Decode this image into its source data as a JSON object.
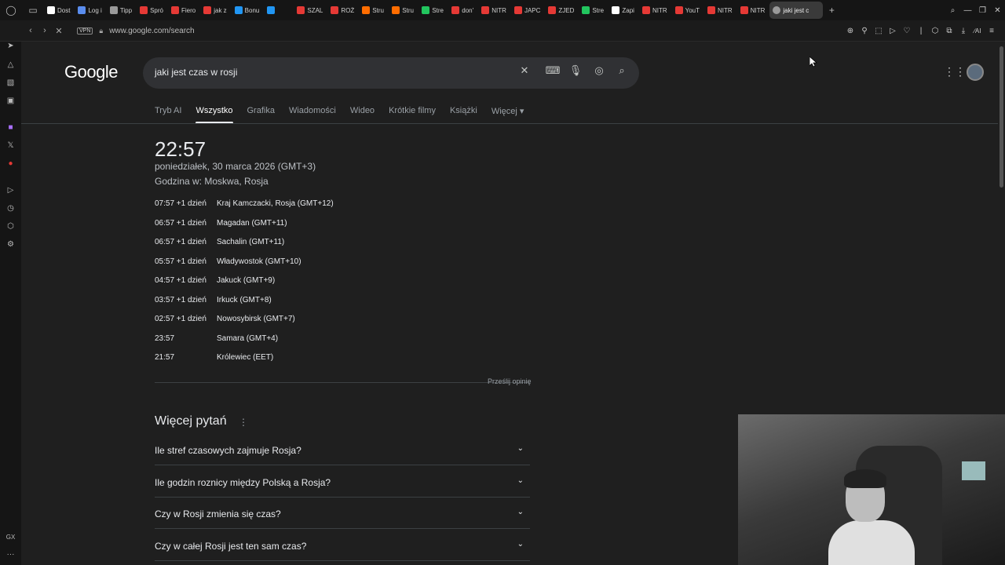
{
  "browser": {
    "tabs": [
      "Dost",
      "Log i",
      "Tipp",
      "Spró",
      "Fiero",
      "jak z",
      "Bonu",
      "",
      "SZAL",
      "ROŻ",
      "Stru",
      "Stru",
      "Stre",
      "don'",
      "NITR",
      "JAPC",
      "ZJED",
      "Stre",
      "Zapi",
      "NITR",
      "YouT",
      "NITR",
      "NITR"
    ],
    "tab_colors": [
      "#ffffff",
      "#5a8dee",
      "#999999",
      "#e53935",
      "#e53935",
      "#e53935",
      "#2196f3",
      "#2196f3",
      "#e53935",
      "#e53935",
      "#ff6d00",
      "#ff6d00",
      "#22c55e",
      "#e53935",
      "#e53935",
      "#e53935",
      "#e53935",
      "#22c55e",
      "#ffffff",
      "#e53935",
      "#e53935",
      "#e53935",
      "#e53935"
    ],
    "active_tab": "jaki jest c",
    "url": "www.google.com/search",
    "vpn_label": "VPN"
  },
  "sidebar_icons": [
    "instagram-icon",
    "messenger-icon",
    "whatsapp-icon",
    "extension-icon",
    "twitch-icon",
    "x-icon",
    "youtube-icon",
    "history-icon",
    "clock-icon",
    "cube-icon",
    "settings-icon",
    "gx-icon",
    "more-icon"
  ],
  "sidebar_bottom_label": "GX",
  "google": {
    "logo": "Google",
    "query": "jaki jest czas w rosji",
    "nav_tabs": [
      {
        "label": "Tryb AI",
        "active": false
      },
      {
        "label": "Wszystko",
        "active": true
      },
      {
        "label": "Grafika",
        "active": false
      },
      {
        "label": "Wiadomości",
        "active": false
      },
      {
        "label": "Wideo",
        "active": false
      },
      {
        "label": "Krótkie filmy",
        "active": false
      },
      {
        "label": "Książki",
        "active": false
      },
      {
        "label": "Więcej ▾",
        "active": false
      }
    ]
  },
  "clock": {
    "time": "22:57",
    "date": "poniedziałek, 30 marca 2026 (GMT+3)",
    "location": "Godzina w: Moskwa, Rosja",
    "zones": [
      {
        "time": "07:57 +1 dzień",
        "name": "Kraj Kamczacki, Rosja (GMT+12)"
      },
      {
        "time": "06:57 +1 dzień",
        "name": "Magadan (GMT+11)"
      },
      {
        "time": "06:57 +1 dzień",
        "name": "Sachalin (GMT+11)"
      },
      {
        "time": "05:57 +1 dzień",
        "name": "Władywostok (GMT+10)"
      },
      {
        "time": "04:57 +1 dzień",
        "name": "Jakuck (GMT+9)"
      },
      {
        "time": "03:57 +1 dzień",
        "name": "Irkuck (GMT+8)"
      },
      {
        "time": "02:57 +1 dzień",
        "name": "Nowosybirsk (GMT+7)"
      },
      {
        "time": "23:57",
        "name": "Samara (GMT+4)"
      },
      {
        "time": "21:57",
        "name": "Królewiec (EET)"
      }
    ],
    "feedback": "Prześlij opinię"
  },
  "more_questions": {
    "title": "Więcej pytań",
    "items": [
      "Ile stref czasowych zajmuje Rosja?",
      "Ile godzin roznicy między Polską a Rosja?",
      "Czy w Rosji zmienia się czas?",
      "Czy w całej Rosji jest ten sam czas?"
    ]
  }
}
